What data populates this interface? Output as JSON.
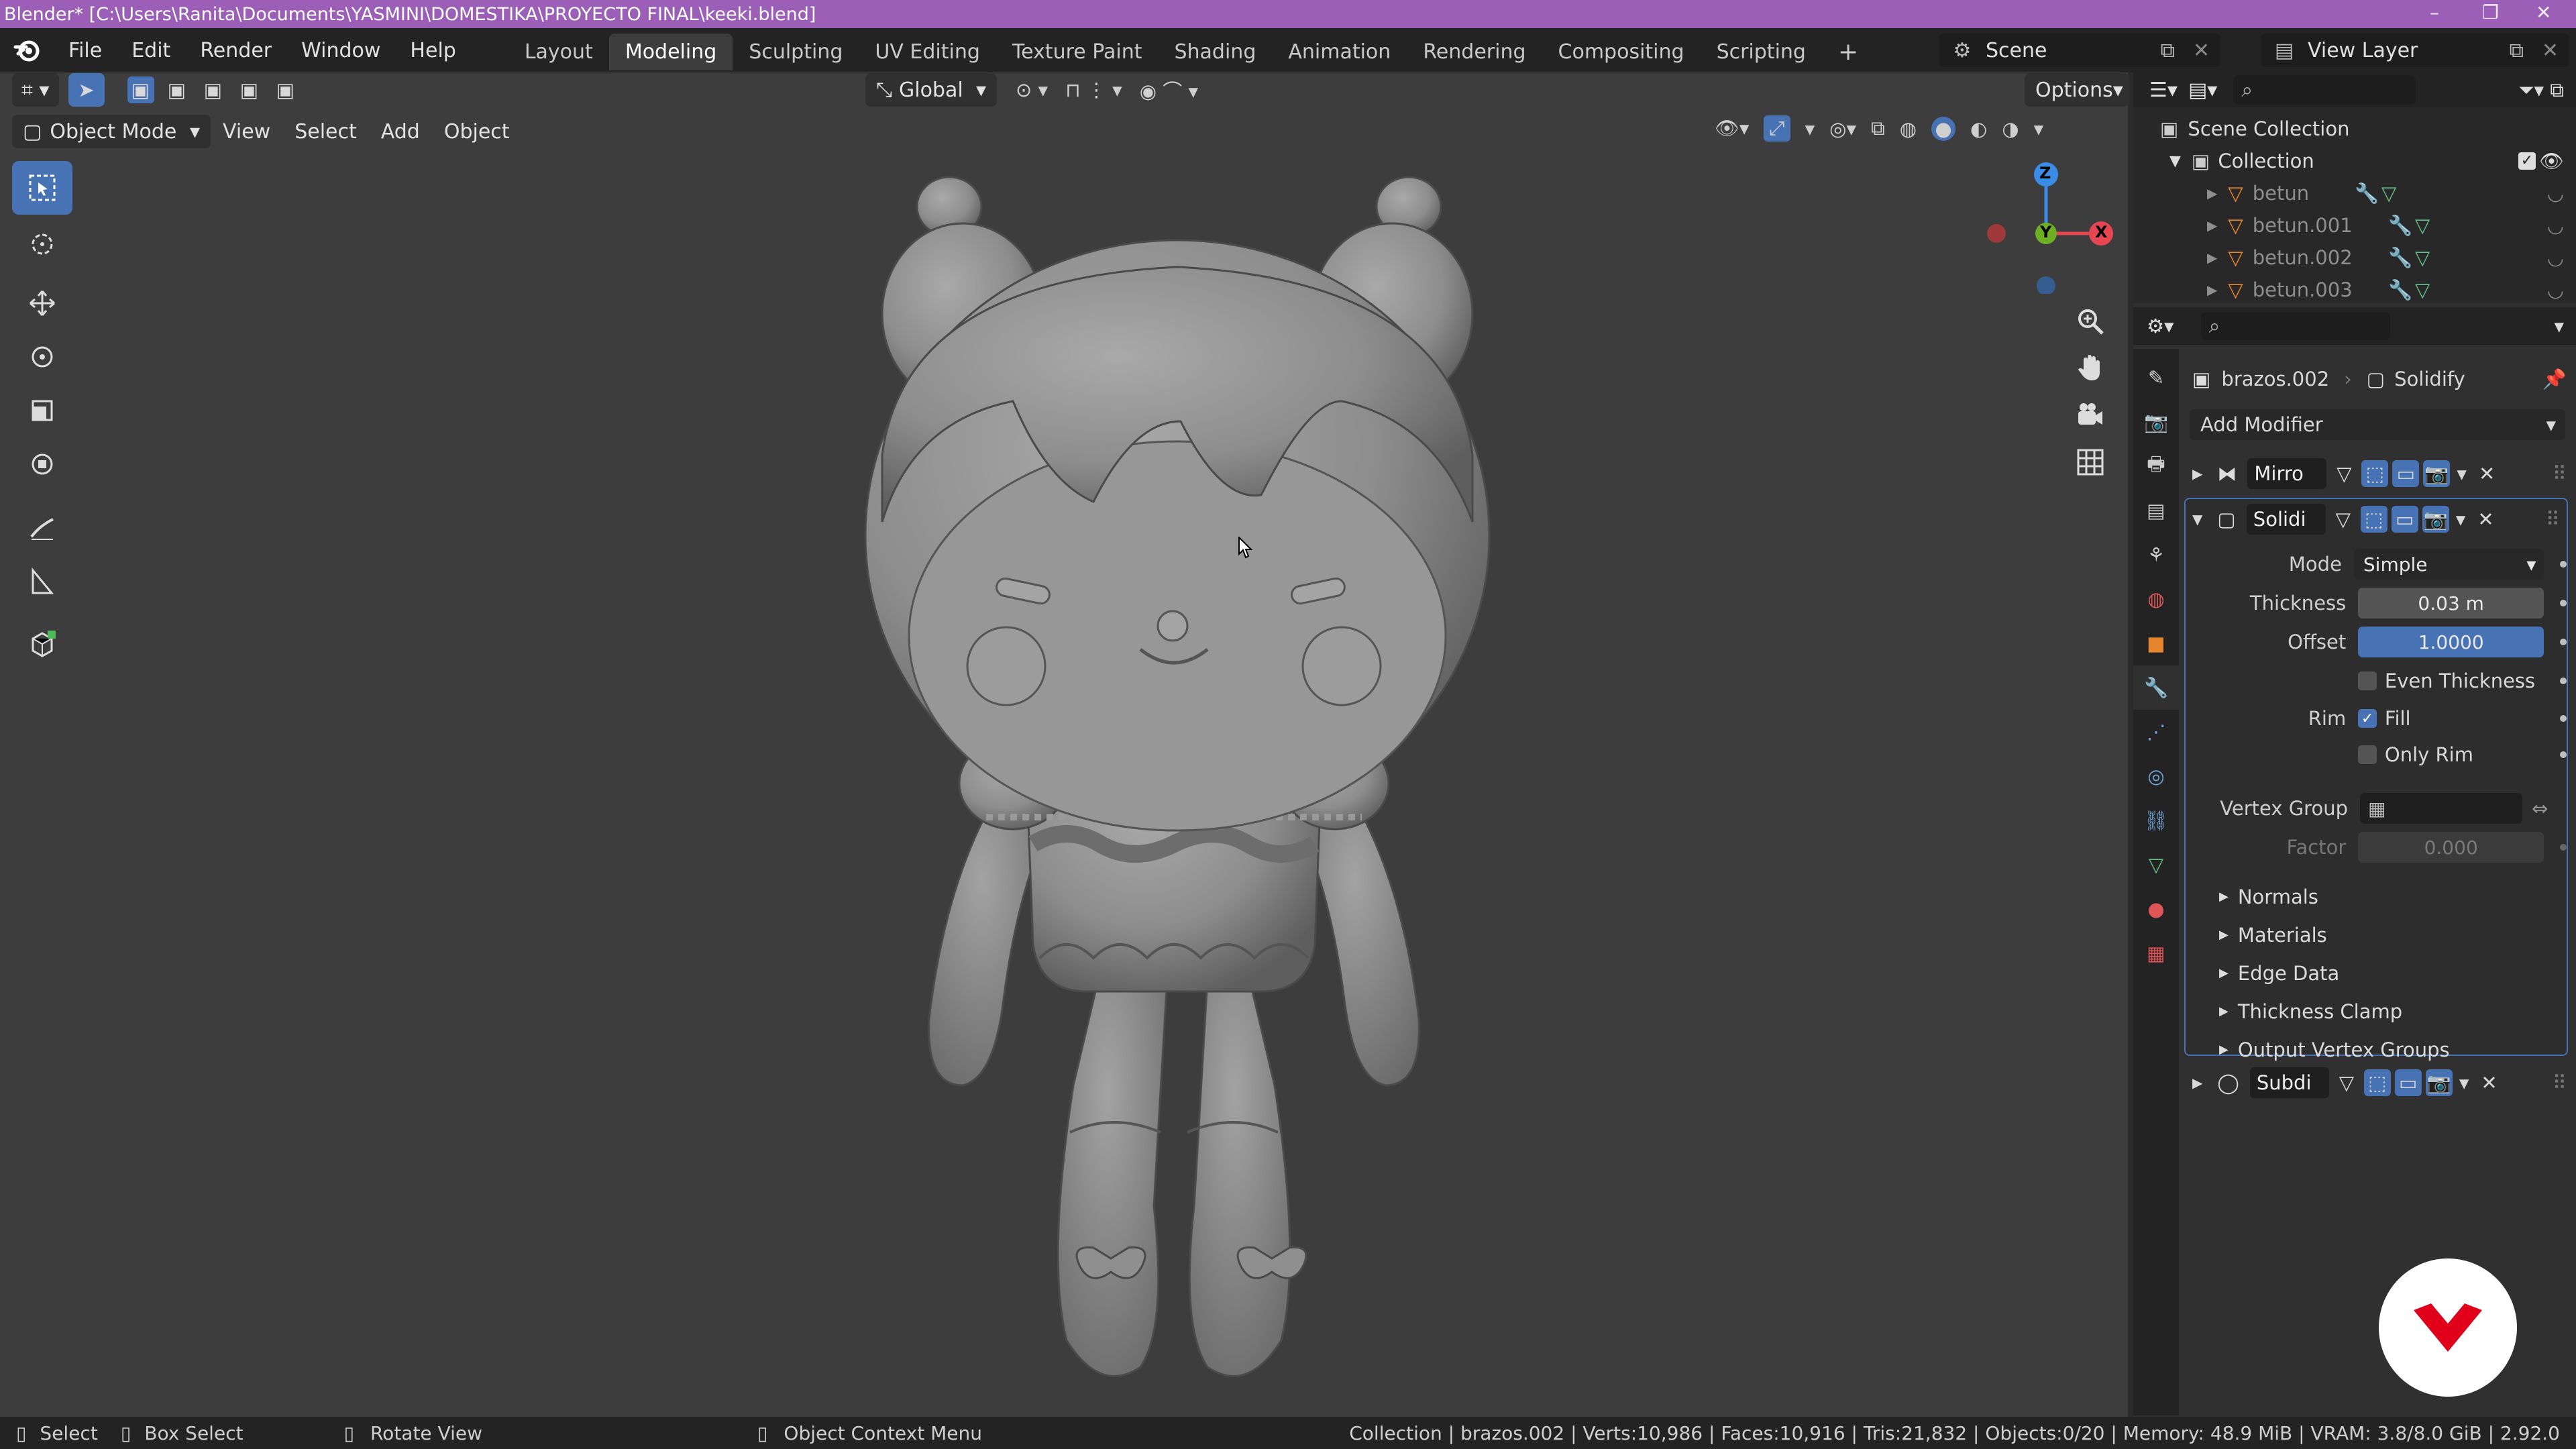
{
  "window": {
    "title": "Blender* [C:\\Users\\Ranita\\Documents\\YASMINI\\DOMESTIKA\\PROYECTO FINAL\\keeki.blend]"
  },
  "menus": [
    "File",
    "Edit",
    "Render",
    "Window",
    "Help"
  ],
  "workspaces": [
    "Layout",
    "Modeling",
    "Sculpting",
    "UV Editing",
    "Texture Paint",
    "Shading",
    "Animation",
    "Rendering",
    "Compositing",
    "Scripting"
  ],
  "active_workspace": "Modeling",
  "scene": {
    "name": "Scene",
    "view_layer": "View Layer"
  },
  "tool_header": {
    "orientation": "Global",
    "options": "Options"
  },
  "viewport_header": {
    "mode": "Object Mode",
    "menus": [
      "View",
      "Select",
      "Add",
      "Object"
    ]
  },
  "gizmo": {
    "x": "X",
    "y": "Y",
    "z": "Z"
  },
  "outliner": {
    "root": "Scene Collection",
    "collection": "Collection",
    "items": [
      "betun",
      "betun.001",
      "betun.002",
      "betun.003"
    ]
  },
  "properties": {
    "object": "brazos.002",
    "modifier_context": "Solidify",
    "add_modifier": "Add Modifier",
    "modifiers": [
      {
        "name": "Mirro",
        "expanded": false
      },
      {
        "name": "Solidi",
        "expanded": true
      },
      {
        "name": "Subdi",
        "expanded": false
      }
    ],
    "solidify": {
      "mode_label": "Mode",
      "mode_value": "Simple",
      "thickness_label": "Thickness",
      "thickness_value": "0.03 m",
      "offset_label": "Offset",
      "offset_value": "1.0000",
      "offset_fill": 1.0,
      "even_thickness_label": "Even Thickness",
      "even_thickness": false,
      "rim_label": "Rim",
      "fill_label": "Fill",
      "fill": true,
      "only_rim_label": "Only Rim",
      "only_rim": false,
      "vertex_group_label": "Vertex Group",
      "vertex_group_value": "",
      "factor_label": "Factor",
      "factor_value": "0.000"
    },
    "subpanels": [
      "Normals",
      "Materials",
      "Edge Data",
      "Thickness Clamp",
      "Output Vertex Groups"
    ]
  },
  "statusbar": {
    "left": [
      "Select",
      "Box Select",
      "Rotate View",
      "Object Context Menu"
    ],
    "right": "Collection | brazos.002 | Verts:10,986 | Faces:10,916 | Tris:21,832 | Objects:0/20 | Memory: 48.9 MiB | VRAM: 3.8/8.0 GiB | 2.92.0"
  },
  "colors": {
    "accent": "#4772b3",
    "titlebar": "#9b5fb7",
    "brand": "#e0001a"
  }
}
